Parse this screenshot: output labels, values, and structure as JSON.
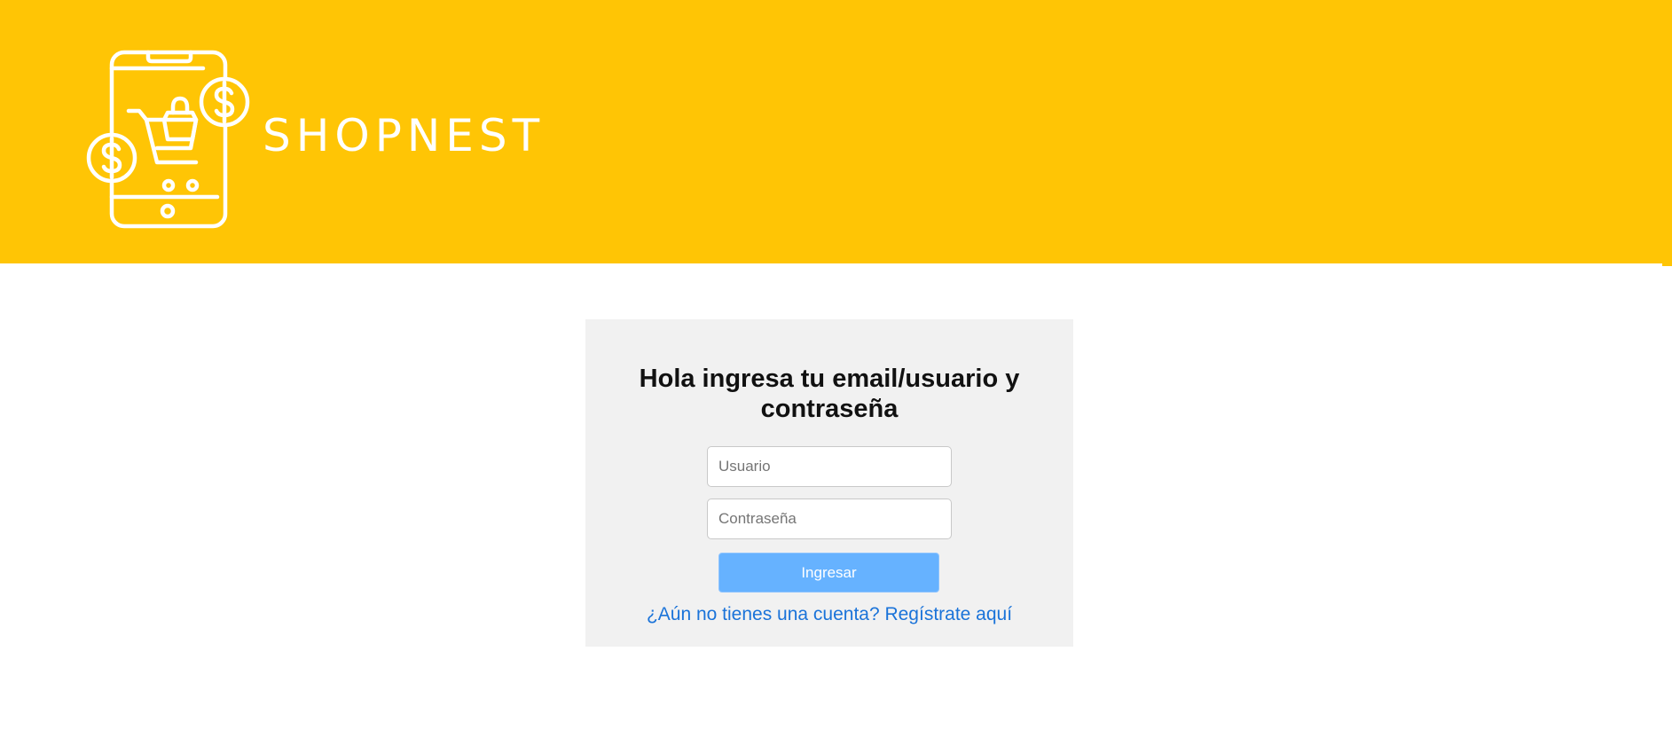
{
  "header": {
    "background_color": "#ffc505",
    "brand_name": "SHOPNEST",
    "logo_icon": "phone-shopping-cart-icon"
  },
  "login": {
    "title": "Hola ingresa tu email/usuario y contraseña",
    "username": {
      "placeholder": "Usuario",
      "value": ""
    },
    "password": {
      "placeholder": "Contraseña",
      "value": ""
    },
    "submit_label": "Ingresar",
    "register_link": "¿Aún no tienes una cuenta? Regístrate aquí",
    "accent_color": "#66b2ff",
    "link_color": "#1a73d9",
    "card_background": "#f1f1f1"
  }
}
